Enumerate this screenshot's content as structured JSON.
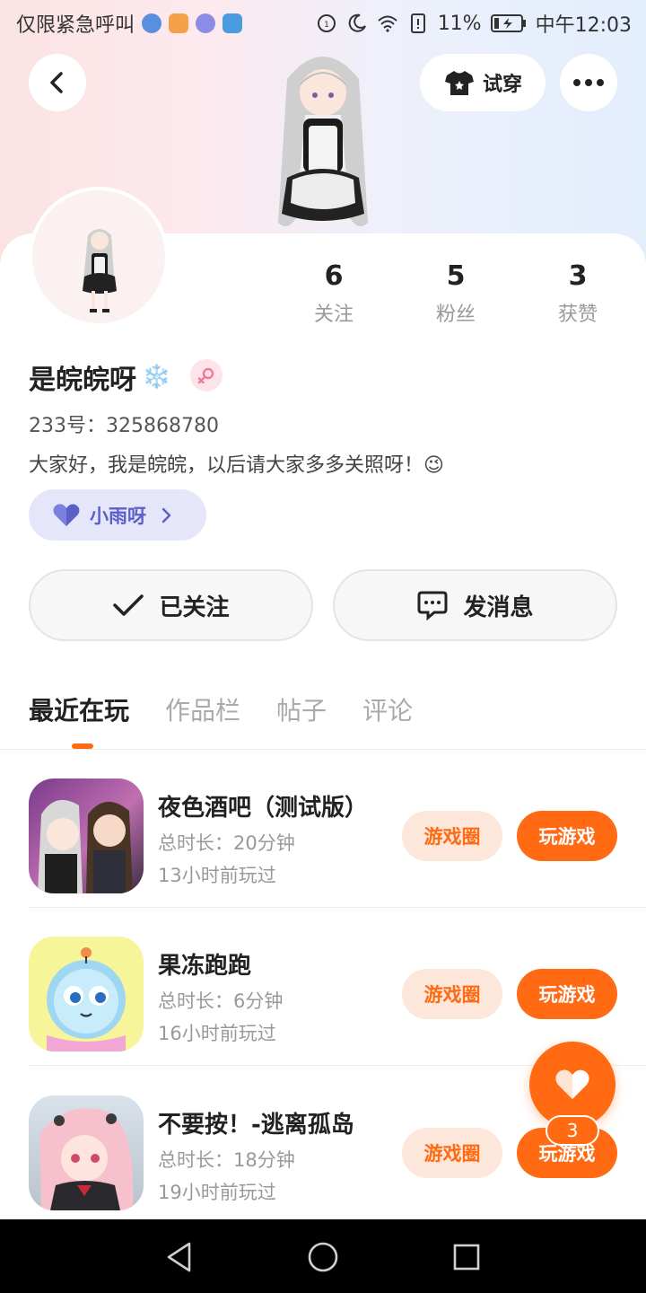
{
  "status_bar": {
    "carrier_text": "仅限紧急呼叫",
    "battery": "11%",
    "time": "中午12:03"
  },
  "header": {
    "tryon_label": "试穿"
  },
  "profile": {
    "stats": [
      {
        "value": "6",
        "label": "关注"
      },
      {
        "value": "5",
        "label": "粉丝"
      },
      {
        "value": "3",
        "label": "获赞"
      }
    ],
    "name": "是皖皖呀",
    "name_emoji": "❄️",
    "uid": "233号：325868780",
    "bio": "大家好，我是皖皖，以后请大家多多关照呀！😉",
    "fan_pill_label": "小雨呀"
  },
  "actions": {
    "follow_label": "已关注",
    "message_label": "发消息"
  },
  "tabs": [
    {
      "label": "最近在玩",
      "active": true
    },
    {
      "label": "作品栏",
      "active": false
    },
    {
      "label": "帖子",
      "active": false
    },
    {
      "label": "评论",
      "active": false
    }
  ],
  "games": [
    {
      "title": "夜色酒吧（测试版）",
      "duration": "总时长：20分钟",
      "last_played": "13小时前玩过",
      "circle_label": "游戏圈",
      "play_label": "玩游戏"
    },
    {
      "title": "果冻跑跑",
      "duration": "总时长：6分钟",
      "last_played": "16小时前玩过",
      "circle_label": "游戏圈",
      "play_label": "玩游戏"
    },
    {
      "title": "不要按！-逃离孤岛",
      "duration": "总时长：18分钟",
      "last_played": "19小时前玩过",
      "circle_label": "游戏圈",
      "play_label": "玩游戏"
    }
  ],
  "floating": {
    "like_count": "3"
  },
  "colors": {
    "accent": "#ff6a13",
    "accent_light": "#fde6da",
    "pill_bg": "#e6e6fa",
    "pill_text": "#5b5fc7"
  }
}
